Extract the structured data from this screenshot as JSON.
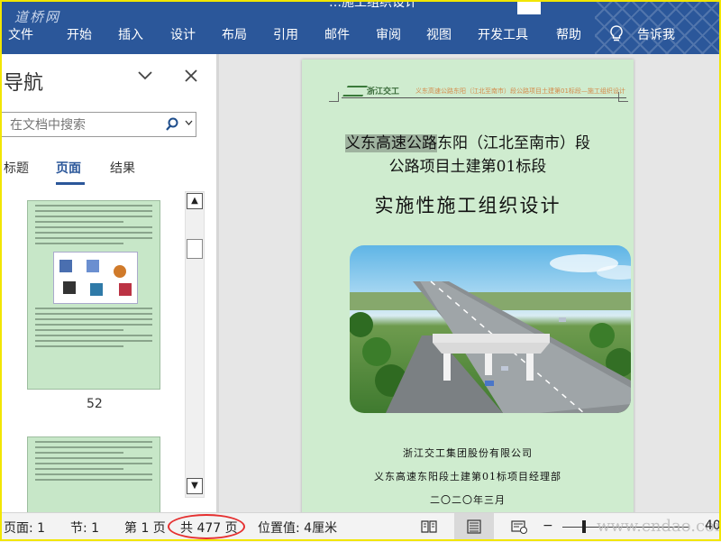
{
  "app": {
    "watermark_top": "道桥网",
    "title_fragment": "…施工组织设计",
    "watermark_bottom": "www.cndao.com"
  },
  "ribbon": {
    "tabs": [
      "文件",
      "开始",
      "插入",
      "设计",
      "布局",
      "引用",
      "邮件",
      "审阅",
      "视图",
      "开发工具",
      "帮助"
    ],
    "tell_me_label": "告诉我",
    "icon_tell_me": "lightbulb-icon"
  },
  "nav_pane": {
    "title": "导航",
    "search_placeholder": "在文档中搜索",
    "tabs": [
      "标题",
      "页面",
      "结果"
    ],
    "active_tab": "页面",
    "thumbnail_page_number": "52",
    "icons": [
      "chevron-down-icon",
      "close-icon",
      "search-icon",
      "scroll-up-icon",
      "scroll-down-icon"
    ]
  },
  "document": {
    "header_logo_text": "浙江交工",
    "header_text": "义东高速公路东阳（江北至南市）段公路项目土建第01标段—施工组织设计",
    "title_line1_highlight": "义东高速公路",
    "title_line1_rest": "东阳（江北至南市）段",
    "title_line2": "公路项目土建第01标段",
    "title_main": "实施性施工组织设计",
    "org_line1": "浙江交工集团股份有限公司",
    "org_line2": "义东高速东阳段土建第01标项目经理部",
    "org_date": "二〇二〇年三月"
  },
  "status_bar": {
    "page": "页面: 1",
    "section": "节: 1",
    "page_of": "第 1 页",
    "total_pages": "共 477 页",
    "position": "位置值: 4厘米",
    "zoom_suffix": "40",
    "highlight_color": "#e53030",
    "icons": [
      "read-mode-icon",
      "print-layout-icon",
      "web-layout-icon"
    ]
  },
  "colors": {
    "ribbon": "#2b579a",
    "page_background": "#cfeccf",
    "accent_tab": "#2b579a"
  }
}
